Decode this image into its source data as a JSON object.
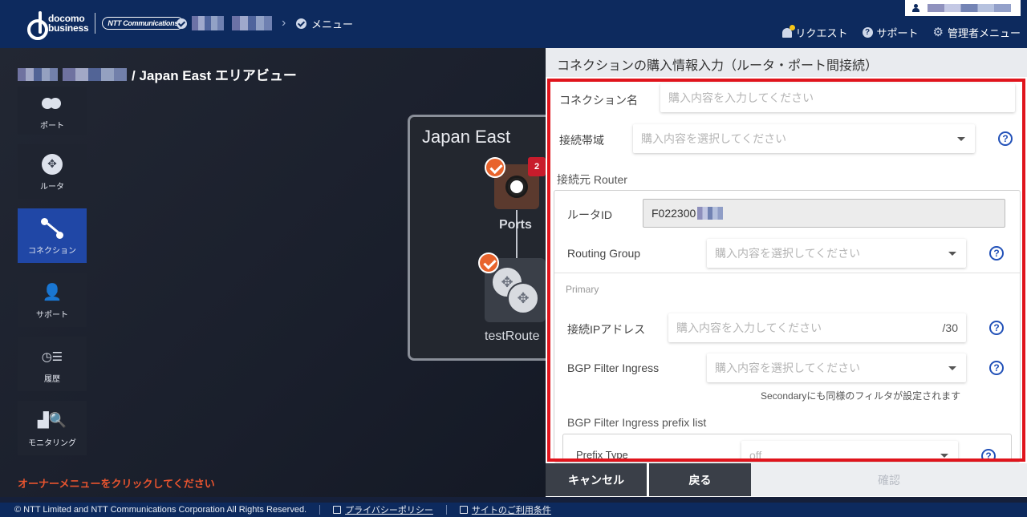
{
  "header": {
    "logo_line1": "docomo",
    "logo_line2": "business",
    "ntt_logo": "NTT Communications",
    "menu_label": "メニュー",
    "nav": {
      "request": "リクエスト",
      "support": "サポート",
      "admin_menu": "管理者メニュー"
    }
  },
  "page": {
    "title": "/ Japan East エリアビュー"
  },
  "sidebar": {
    "items": [
      {
        "label": "ポート",
        "icon": "port-icon"
      },
      {
        "label": "ルータ",
        "icon": "router-icon"
      },
      {
        "label": "コネクション",
        "icon": "connection-icon"
      },
      {
        "label": "サポート",
        "icon": "support-icon"
      },
      {
        "label": "履歴",
        "icon": "history-icon"
      },
      {
        "label": "モニタリング",
        "icon": "monitoring-icon"
      }
    ]
  },
  "hint": "オーナーメニューをクリックしてください",
  "diagram": {
    "area_title": "Japan East",
    "ports_label": "Ports",
    "ports_badge": "2",
    "router_label": "testRoute"
  },
  "panel": {
    "title": "コネクションの購入情報入力（ルータ・ポート間接続）",
    "connection_name_label": "コネクション名",
    "connection_name_placeholder": "購入内容を入力してください",
    "bandwidth_label": "接続帯域",
    "bandwidth_placeholder": "購入内容を選択してください",
    "source_router_section": "接続元 Router",
    "router_id_label": "ルータID",
    "router_id_value": "F022300",
    "routing_group_label": "Routing Group",
    "routing_group_placeholder": "購入内容を選択してください",
    "primary_label": "Primary",
    "ip_label": "接続IPアドレス",
    "ip_placeholder": "購入内容を入力してください",
    "ip_suffix": "/30",
    "bgp_ingress_label": "BGP Filter Ingress",
    "bgp_ingress_placeholder": "購入内容を選択してください",
    "bgp_note": "Secondaryにも同様のフィルタが設定されます",
    "bgp_prefix_section": "BGP Filter Ingress prefix list",
    "prefix_type_label": "Prefix Type",
    "prefix_type_value": "off"
  },
  "buttons": {
    "cancel": "キャンセル",
    "back": "戻る",
    "confirm": "確認"
  },
  "footer": {
    "copyright": "© NTT Limited and NTT Communications Corporation All Rights Reserved.",
    "privacy": "プライバシーポリシー",
    "terms": "サイトのご利用条件"
  },
  "colors": {
    "header_bg": "#0d2a5e",
    "active_nav": "#2047a6",
    "highlight_frame": "#e0141c",
    "check_badge": "#e8632c",
    "help_icon": "#2251b8"
  }
}
